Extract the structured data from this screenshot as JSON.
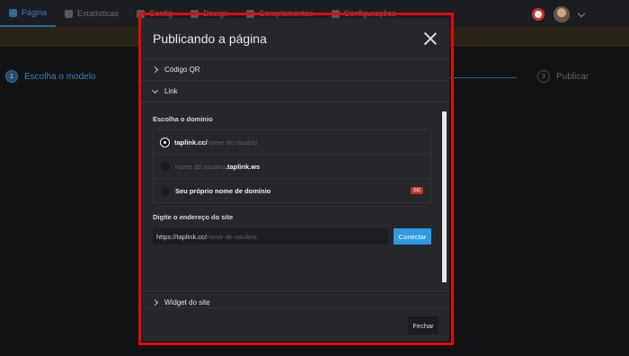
{
  "nav": {
    "items": [
      {
        "label": "Página",
        "active": true
      },
      {
        "label": "Estatísticas"
      },
      {
        "label": "Config"
      },
      {
        "label": "Design"
      },
      {
        "label": "Complementos"
      },
      {
        "label": "Configurações"
      }
    ]
  },
  "steps": {
    "step1": {
      "num": "1",
      "label": "Escolha o modelo"
    },
    "step3": {
      "num": "3",
      "label": "Publicar"
    }
  },
  "modal": {
    "title": "Publicando a página",
    "qr_label": "Código QR",
    "link_label": "Link",
    "domain_section_label": "Escolha o domínio",
    "domain_options": [
      {
        "domain": "taplink.cc/",
        "placeholder": "nome de usuário",
        "selected": true
      },
      {
        "placeholder": "nome de usuário",
        "domain": ".taplink.ws"
      },
      {
        "label": "Seu próprio nome de domínio",
        "badge": "biz"
      }
    ],
    "address_label": "Digite o endereço do site",
    "url_prefix": "https://taplink.cc/",
    "url_placeholder": "nome de usuário",
    "connect_label": "Conectar",
    "widget_label": "Widget do site",
    "close_label": "Fechar"
  },
  "colors": {
    "accent": "#2e9be4",
    "highlight": "#e00a0a",
    "badge": "#c0392b"
  }
}
